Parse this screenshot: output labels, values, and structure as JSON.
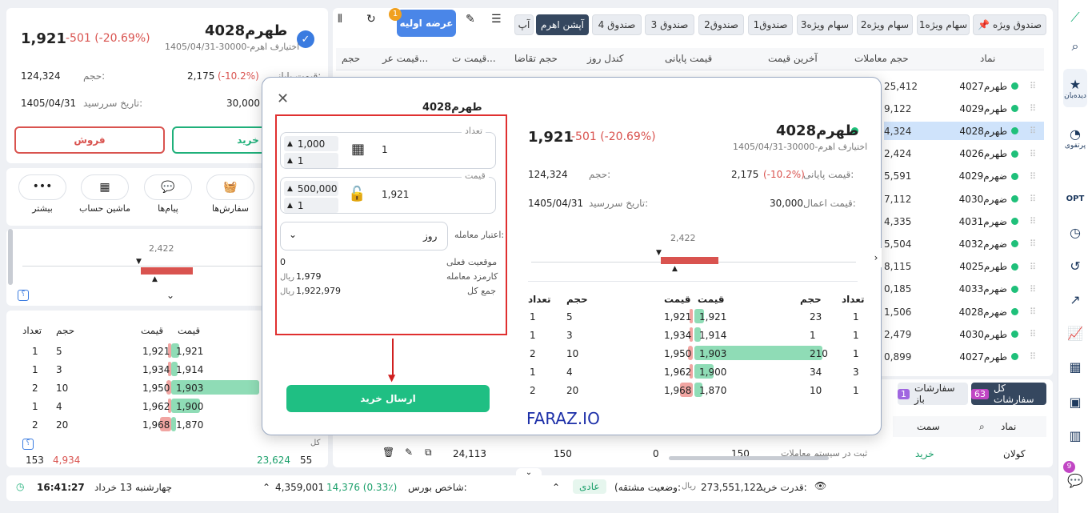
{
  "left": {
    "symbol": "طهرم4028",
    "subtitle": "اختیارف اهرم-30000-1405/04/31",
    "price": "1,921",
    "change": "-501 (-20.69%)",
    "vol_label": "حجم:",
    "vol": "124,324",
    "close_label": "قیمت پایانی:",
    "close": "2,175",
    "close_pct": "(-10.2%)",
    "expiry_label": "تاریخ سررسید:",
    "expiry": "1405/04/31",
    "strike": "30,000",
    "sell": "فروش",
    "buy": "خرید",
    "tools": [
      {
        "label": "سفارش‌ها",
        "icon": "basket-icon"
      },
      {
        "label": "پیام‌ها",
        "icon": "chat-icon"
      },
      {
        "label": "ماشین حساب",
        "icon": "calculator-icon"
      },
      {
        "label": "بیشتر",
        "icon": "more-icon"
      }
    ],
    "slider_val": "2,422",
    "help": "؟",
    "ob_headers": [
      "تعداد",
      "حجم",
      "قیمت",
      "قیمت"
    ],
    "ob_rows": [
      [
        "1",
        "5",
        "1,921",
        "1,921"
      ],
      [
        "1",
        "3",
        "1,934",
        "1,914"
      ],
      [
        "2",
        "10",
        "1,950",
        "1,903"
      ],
      [
        "1",
        "4",
        "1,962",
        "1,900"
      ],
      [
        "2",
        "20",
        "1,968",
        "1,870"
      ]
    ],
    "footer": [
      "153",
      "4,934",
      "23,624",
      "55"
    ],
    "footer_label": "کل"
  },
  "tabs": [
    "صندوق ویژه",
    "سهام ویژه1",
    "سهام ویژه2",
    "سهام ویژه3",
    "صندوق1",
    "صندوق2",
    "صندوق 3",
    "صندوق 4",
    "آپشن اهرم",
    "آپ"
  ],
  "ipo": {
    "label": "عرضه اولیه",
    "badge": "1"
  },
  "table": {
    "headers": [
      "نماد",
      "حجم معاملات",
      "آخرین قیمت",
      "قیمت پایانی",
      "کندل روز",
      "حجم تقاضا",
      "قیمت ت...",
      "قیمت عر...",
      "حجم"
    ],
    "rows": [
      [
        "طهرم4027",
        "25,412"
      ],
      [
        "طهرم4029",
        "9,122"
      ],
      [
        "طهرم4028",
        "4,324"
      ],
      [
        "طهرم4026",
        "2,424"
      ],
      [
        "ضهرم4029",
        "5,591"
      ],
      [
        "ضهرم4030",
        "7,112"
      ],
      [
        "ضهرم4031",
        "4,335"
      ],
      [
        "ضهرم4032",
        "5,504"
      ],
      [
        "طهرم4025",
        "8,115"
      ],
      [
        "ضهرم4033",
        "0,185"
      ],
      [
        "ضهرم4028",
        "1,506"
      ],
      [
        "طهرم4030",
        "2,479"
      ],
      [
        "طهرم4027",
        "0,899"
      ]
    ]
  },
  "orders": {
    "all": "کل سفارشات",
    "all_count": "63",
    "open": "سفارشات باز",
    "open_count": "1",
    "cols": [
      "نماد",
      "سمت"
    ],
    "row": {
      "sym": "کولان",
      "side": "خرید",
      "vals": [
        "24,113",
        "150",
        "0",
        "150"
      ]
    },
    "misc": "ثبت در سیستم معاملات"
  },
  "modal": {
    "title": "طهرم4028",
    "qty_label": "تعداد",
    "qty": "1",
    "qty_step": "1,000",
    "qty_step2": "1",
    "price_label": "قیمت",
    "price": "1,921",
    "price_step": "500,000",
    "price_step2": "1",
    "validity_label": "اعتبار معامله:",
    "validity": "روز",
    "pos_label": "موقعیت فعلی",
    "pos": "0",
    "fee_label": "کارمزد معامله",
    "fee": "1,979",
    "total_label": "جمع کل",
    "total": "1,922,979",
    "rial": "ریال",
    "submit": "ارسال خرید",
    "watermark": "FARAZ.IO",
    "info": {
      "symbol": "طهرم4028",
      "subtitle": "اختیارف اهرم-30000-1405/04/31",
      "price": "1,921",
      "change": "-501 (-20.69%)",
      "vol_label": "حجم:",
      "vol": "124,324",
      "close_label": "قیمت پایانی:",
      "close": "2,175",
      "close_pct": "(-10.2%)",
      "expiry_label": "تاریخ سررسید:",
      "expiry": "1405/04/31",
      "strike_label": "قیمت اعمال:",
      "strike": "30,000",
      "slider_val": "2,422",
      "ob_headers": [
        "تعداد",
        "حجم",
        "قیمت",
        "قیمت",
        "حجم",
        "تعداد"
      ],
      "ob_rows": [
        [
          "1",
          "5",
          "1,921",
          "1,921",
          "23",
          "1"
        ],
        [
          "1",
          "3",
          "1,934",
          "1,914",
          "1",
          "1"
        ],
        [
          "2",
          "10",
          "1,950",
          "1,903",
          "210",
          "1"
        ],
        [
          "1",
          "4",
          "1,962",
          "1,900",
          "34",
          "3"
        ],
        [
          "2",
          "20",
          "1,968",
          "1,870",
          "10",
          "1"
        ]
      ]
    }
  },
  "status": {
    "time": "16:41:27",
    "date": "چهارشنبه 13 خرداد",
    "index_label": "شاخص بورس:",
    "index": "4,359,001",
    "index_change": "14,376 (0.33٪)",
    "power_label": "قدرت خرید:",
    "power": "273,551,122",
    "rial": "ریال",
    "cust_label": "(وضعیت مشتقه:",
    "cust": "عادی"
  },
  "nav": [
    {
      "icon": "logo-icon"
    },
    {
      "icon": "search-icon"
    },
    {
      "icon": "watchlist-icon",
      "label": "دیده‌بان"
    },
    {
      "icon": "portfolio-icon",
      "label": "پرتفوی"
    },
    {
      "icon": "opt-icon",
      "label": "OPT"
    },
    {
      "icon": "timer-icon"
    },
    {
      "icon": "history-icon"
    },
    {
      "icon": "strategy-icon"
    },
    {
      "icon": "chart-icon"
    },
    {
      "icon": "grid-icon"
    },
    {
      "icon": "box-icon"
    },
    {
      "icon": "stats-icon"
    },
    {
      "icon": "chat-icon",
      "badge": "9"
    }
  ]
}
